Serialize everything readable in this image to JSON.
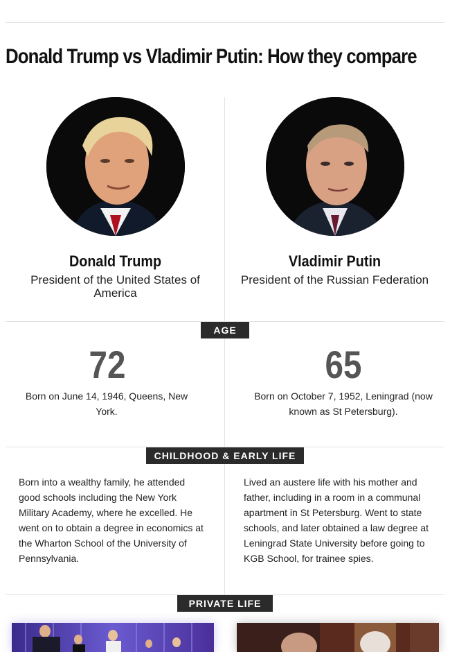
{
  "title": "Donald Trump vs Vladimir Putin: How they compare",
  "people": [
    {
      "name": "Donald Trump",
      "role": "President of the United States of America",
      "age": "72",
      "born": "Born on June 14, 1946, Queens, New York.",
      "childhood": "Born into a wealthy family, he attended good schools including the New York Military Academy, where he excelled. He went on to obtain a degree in economics at the Wharton School of the University of Pennsylvania."
    },
    {
      "name": "Vladimir Putin",
      "role": "President of the Russian Federation",
      "age": "65",
      "born": "Born on October 7, 1952, Leningrad (now known as St Petersburg).",
      "childhood": "Lived an austere life with his mother and father, including in a room in a communal apartment in St Petersburg. Went to state schools, and later obtained a law degree at Leningrad State University before going to KGB School, for trainee spies."
    }
  ],
  "sections": {
    "age": "AGE",
    "childhood": "CHILDHOOD & EARLY LIFE",
    "private": "PRIVATE LIFE"
  },
  "colors": {
    "tag_background": "#2b2b2b",
    "age_number": "#555555",
    "rule": "#e3e3e3"
  }
}
